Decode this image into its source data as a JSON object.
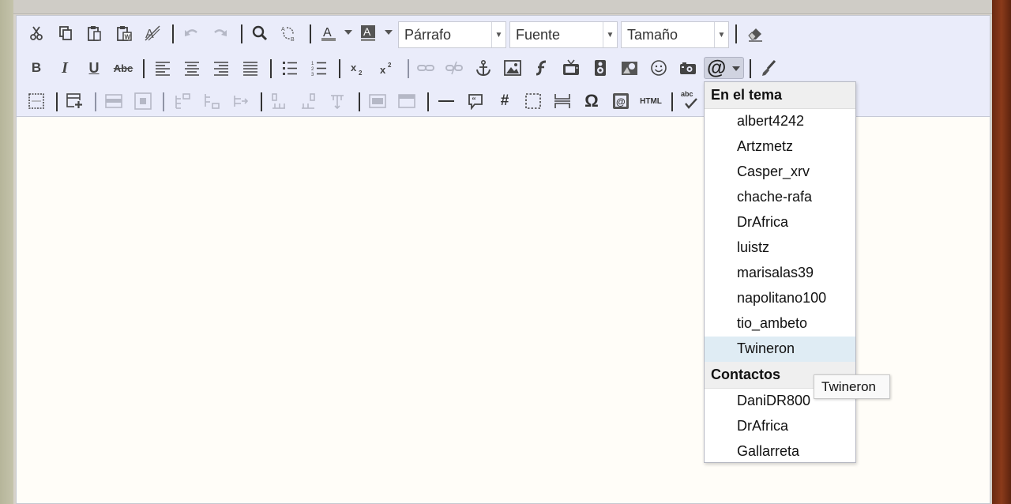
{
  "format": {
    "block_placeholder": "Párrafo",
    "font_placeholder": "Fuente",
    "size_placeholder": "Tamaño"
  },
  "toolbar": {
    "bold_label": "B",
    "italic_label": "I",
    "underline_label": "U",
    "strike_label": "Abc",
    "html_label": "HTML",
    "spell_label": "abc",
    "hash_label": "#",
    "omega_label": "Ω",
    "mention_label": "@"
  },
  "mention_menu": {
    "sections": [
      {
        "title": "En el tema",
        "items": [
          "albert4242",
          "Artzmetz",
          "Casper_xrv",
          "chache-rafa",
          "DrAfrica",
          "luistz",
          "marisalas39",
          "napolitano100",
          "tio_ambeto",
          "Twineron"
        ]
      },
      {
        "title": "Contactos",
        "items": [
          "DaniDR800",
          "DrAfrica",
          "Gallarreta"
        ]
      }
    ],
    "hovered_item": "Twineron"
  },
  "tooltip": {
    "text": "Twineron"
  },
  "colors": {
    "toolbar_bg": "#eaecfa",
    "hover_bg": "#dfecf4",
    "page_bg": "#fffdf8"
  }
}
